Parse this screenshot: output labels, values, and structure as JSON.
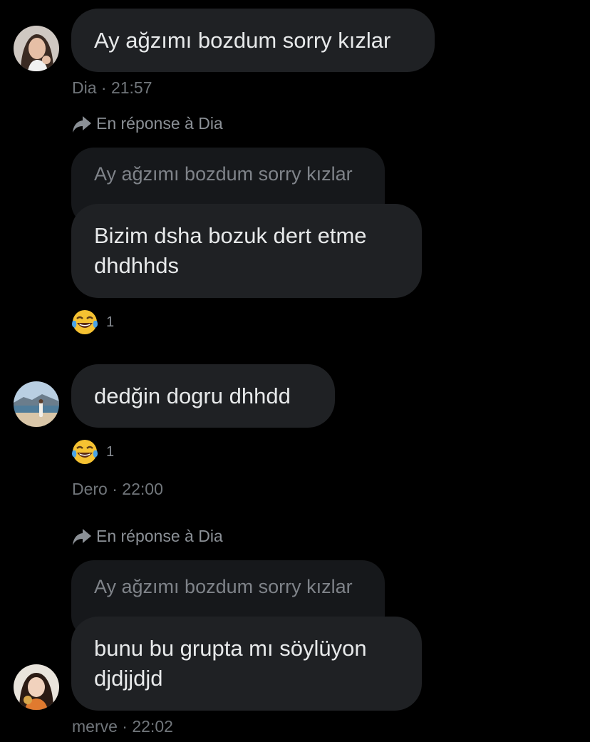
{
  "icons": {
    "reply": "curved-arrow-reply-icon",
    "reaction": "face-with-tears-of-joy-emoji"
  },
  "colors": {
    "background": "#000000",
    "bubble": "#1f2124",
    "quote_bubble": "#16181b",
    "text": "#e7e9ea",
    "muted": "#71767b"
  },
  "messages": [
    {
      "author": "Dia",
      "time": "· 21:57",
      "text": "Ay ağzımı bozdum sorry kızlar"
    },
    {
      "reply_to": "En réponse à Dia",
      "quoted": "Ay ağzımı bozdum sorry kızlar",
      "text": "Bizim dsha bozuk dert etme\ndhdhhds",
      "reaction_count": "1"
    },
    {
      "text": "dedğin dogru dhhdd",
      "reaction_count": "1",
      "author": "Dero",
      "time": "· 22:00"
    },
    {
      "reply_to": "En réponse à Dia",
      "quoted": "Ay ağzımı bozdum sorry kızlar",
      "text": "bunu bu grupta mı söylüyon\ndjdjjdjd",
      "author": "merve",
      "time": "· 22:02"
    }
  ]
}
